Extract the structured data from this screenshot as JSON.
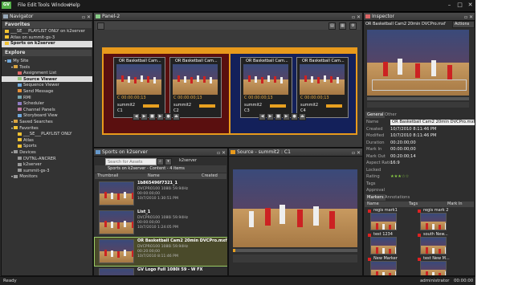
{
  "app": {
    "logo_text": "GV",
    "menu": [
      "File",
      "Edit",
      "Tools",
      "Window",
      "Help"
    ]
  },
  "navigator": {
    "title": "Navigator",
    "favorites_label": "Favorites",
    "favorites": [
      "___SE___PLAYLIST ONLY on k2server",
      "Atlas on summit-gs-3",
      "Sports on k2server"
    ],
    "explore_label": "Explore",
    "tree": [
      {
        "label": "My Site",
        "indent": 0,
        "color": "#6fa8dc"
      },
      {
        "label": "Tools",
        "indent": 1,
        "color": "#d9a441"
      },
      {
        "label": "Assignment List",
        "indent": 2,
        "color": "#e06666"
      },
      {
        "label": "Source Viewer",
        "indent": 2,
        "color": "#93c47d",
        "selected": true
      },
      {
        "label": "Sequence Viewer",
        "indent": 2,
        "color": "#6fa8dc"
      },
      {
        "label": "Send Message",
        "indent": 2,
        "color": "#e69138"
      },
      {
        "label": "RMI",
        "indent": 2,
        "color": "#76a5af"
      },
      {
        "label": "Scheduler",
        "indent": 2,
        "color": "#8e7cc3"
      },
      {
        "label": "Channel Panels",
        "indent": 2,
        "color": "#c27ba0"
      },
      {
        "label": "Storyboard View",
        "indent": 2,
        "color": "#6fa8dc"
      },
      {
        "label": "Saved Searches",
        "indent": 1,
        "color": "#d9a441"
      },
      {
        "label": "Favorites",
        "indent": 1,
        "color": "#f1c232"
      },
      {
        "label": "___SE___PLAYLIST ONLY",
        "indent": 2,
        "color": "#f1c232"
      },
      {
        "label": "Atlas",
        "indent": 2,
        "color": "#f1c232"
      },
      {
        "label": "Sports",
        "indent": 2,
        "color": "#f1c232"
      },
      {
        "label": "Devices",
        "indent": 1,
        "color": "#999999"
      },
      {
        "label": "DVTNL-ANCRER",
        "indent": 2,
        "color": "#999999"
      },
      {
        "label": "k2server",
        "indent": 2,
        "color": "#999999"
      },
      {
        "label": "summit-gs-3",
        "indent": 2,
        "color": "#999999"
      },
      {
        "label": "Monitors",
        "indent": 1,
        "color": "#999999"
      }
    ]
  },
  "panel2": {
    "title": "Panel-2",
    "group1": [
      {
        "name": "OR Basketball Cam...",
        "timecode": "C 00:00:00;13",
        "server": "summit2",
        "id": "C1"
      },
      {
        "name": "OR Basketball Cam...",
        "timecode": "C 00:00:00;13",
        "server": "summit2",
        "id": "C2"
      }
    ],
    "group2": [
      {
        "name": "OR Basketball Cam...",
        "timecode": "C 00:00:00;13",
        "server": "summit2",
        "id": "C3"
      },
      {
        "name": "OR Basketball Cam...",
        "timecode": "C 00:00:00;13",
        "server": "summit2",
        "id": "C4"
      }
    ],
    "group1_color": "#5a0f0f",
    "group2_color": "#13205a"
  },
  "sports": {
    "title": "Sports on k2server",
    "search_placeholder": "Search for Assets",
    "server": "k2server",
    "breadcrumb": "Sports on k2server - Content - 4 items",
    "columns": [
      "Thumbnail",
      "Name",
      "Created"
    ],
    "items": [
      {
        "name": "1b865496f7321_1",
        "format": "DVCPRO100 1080i 59.94Hz",
        "duration": "00:00:00;00",
        "created": "10/7/2010 1:30:51 PM",
        "selected": false
      },
      {
        "name": "List_1",
        "format": "DVCPRO100 1080i 59.94Hz",
        "duration": "00:00:00;00",
        "created": "10/7/2010 1:24:05 PM",
        "selected": false
      },
      {
        "name": "OR Basketball Cam2 20min DVCPro.mxf",
        "format": "DVCPRO100 1080i 59.94Hz",
        "duration": "00:20:00;00",
        "created": "10/7/2010 8:11:46 PM",
        "selected": true
      },
      {
        "name": "GV Logo Full 1080i 59 - W FX",
        "format": "",
        "duration": "",
        "created": "",
        "selected": false
      }
    ]
  },
  "source": {
    "title": "Source - summit2 : C1"
  },
  "inspector": {
    "title": "Inspector",
    "asset": "OR Basketball Cam2 20min DVCPro.mxf",
    "actions": "Actions",
    "tabs": [
      "General",
      "Other"
    ],
    "fields": [
      {
        "label": "Name",
        "value": "OR Basketball Cam2 20min DVCPro.mxf"
      },
      {
        "label": "Created",
        "value": "10/7/2010 8:11:46 PM"
      },
      {
        "label": "Modified",
        "value": "10/7/2010 8:11:46 PM"
      },
      {
        "label": "Duration",
        "value": "00:20:00;00"
      },
      {
        "label": "Mark In",
        "value": "00:00:00;00"
      },
      {
        "label": "Mark Out",
        "value": "00:20:00;14"
      },
      {
        "label": "Aspect Ratio",
        "value": "16:9"
      },
      {
        "label": "Locked",
        "value": ""
      },
      {
        "label": "Rating",
        "value": "★★★☆☆"
      },
      {
        "label": "Tags",
        "value": ""
      },
      {
        "label": "Approval",
        "value": ""
      }
    ],
    "markers_tabs": [
      "Markers",
      "Annotations"
    ],
    "marker_columns": [
      "Name",
      "Tags",
      "Mark In"
    ],
    "markers": [
      {
        "name": "regis mark1"
      },
      {
        "name": "regis mark 2"
      },
      {
        "name": "test 1234"
      },
      {
        "name": "south New..."
      },
      {
        "name": "New Marker"
      },
      {
        "name": "test New M..."
      }
    ]
  },
  "status": {
    "left": "Ready",
    "user": "administrator",
    "time": "00:00:00"
  }
}
